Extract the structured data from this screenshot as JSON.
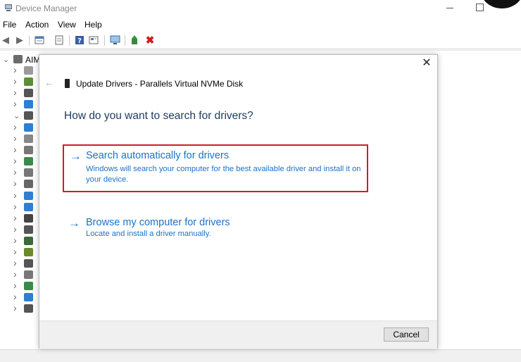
{
  "window": {
    "title": "Device Manager"
  },
  "menu": [
    "File",
    "Action",
    "View",
    "Help"
  ],
  "toolbar": {
    "icons": [
      "back-arrow-icon",
      "forward-arrow-icon",
      "properties-icon",
      "show-hidden-icon",
      "help-icon",
      "action-view-icon",
      "monitor-scan-icon",
      "update-driver-icon",
      "uninstall-icon"
    ]
  },
  "tree": {
    "root_label": "AIM",
    "item_colors": [
      "#9a9a9a",
      "#5b8f3a",
      "#555555",
      "#2f7fd1",
      "#555555",
      "#2f7fd1",
      "#888888",
      "#777777",
      "#3a8a4a",
      "#777777",
      "#666666",
      "#2f7fd1",
      "#2f7fd1",
      "#444444",
      "#555555",
      "#3a6a3a",
      "#6a8a2a",
      "#555555",
      "#777777",
      "#3a8a4a",
      "#2f7fd1",
      "#555555"
    ]
  },
  "dialog": {
    "title": "Update Drivers - Parallels Virtual NVMe Disk",
    "question": "How do you want to search for drivers?",
    "option_auto": {
      "title": "Search automatically for drivers",
      "description": "Windows will search your computer for the best available driver and install it on your device."
    },
    "option_browse": {
      "title": "Browse my computer for drivers",
      "description": "Locate and install a driver manually."
    },
    "cancel_label": "Cancel",
    "accent_color": "#1a73c8",
    "highlight_color": "#cc1f28"
  }
}
